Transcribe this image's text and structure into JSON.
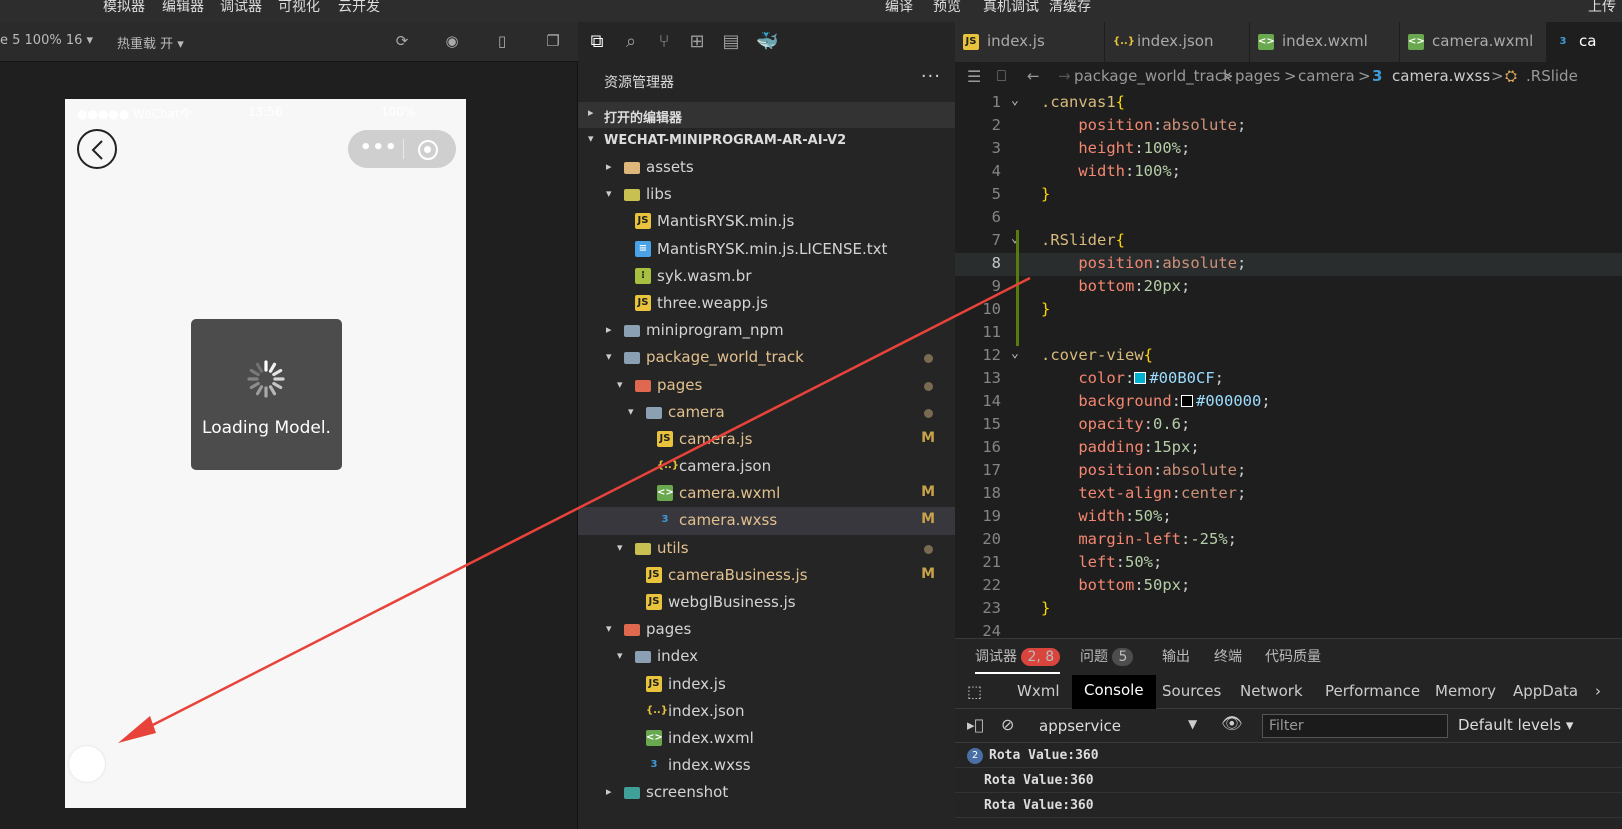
{
  "menu": {
    "items": [
      "模拟器",
      "编辑器",
      "调试器",
      "可视化",
      "云开发"
    ],
    "right_items": [
      "编译",
      "预览",
      "真机调试",
      "清缓存"
    ],
    "upload": "上传"
  },
  "simulator": {
    "device_label": "e 5 100% 16 ▾",
    "hot_reload": "热重载 开 ▾",
    "status_bar": {
      "signal": "●●●●● WeChat令",
      "time": "13:56",
      "battery": "100%"
    },
    "capsule_dots": "•••",
    "toast_text": "Loading Model."
  },
  "explorer": {
    "title": "资源管理器",
    "open_editors": "打开的编辑器",
    "project": "WECHAT-MINIPROGRAM-AR-AI-V2",
    "tree": [
      {
        "name": "assets",
        "type": "folder",
        "depth": 0,
        "arrow": "▸",
        "icon": "folder",
        "color": "folder"
      },
      {
        "name": "libs",
        "type": "folder",
        "depth": 0,
        "arrow": "▾",
        "icon": "folder",
        "color": "folder-g"
      },
      {
        "name": "MantisRYSK.min.js",
        "type": "file",
        "depth": 1,
        "icon": "JS",
        "color": "js"
      },
      {
        "name": "MantisRYSK.min.js.LICENSE.txt",
        "type": "file",
        "depth": 1,
        "icon": "≡",
        "color": "txtf"
      },
      {
        "name": "syk.wasm.br",
        "type": "file",
        "depth": 1,
        "icon": "⁝",
        "color": "br"
      },
      {
        "name": "three.weapp.js",
        "type": "file",
        "depth": 1,
        "icon": "JS",
        "color": "js"
      },
      {
        "name": "miniprogram_npm",
        "type": "folder",
        "depth": 0,
        "arrow": "▸",
        "icon": "folder",
        "color": "folder-b"
      },
      {
        "name": "package_world_track",
        "type": "folder",
        "depth": 0,
        "arrow": "▾",
        "icon": "folder",
        "color": "folder-b",
        "dot": true,
        "mod": true
      },
      {
        "name": "pages",
        "type": "folder",
        "depth": 1,
        "arrow": "▾",
        "icon": "folder",
        "color": "folder-r",
        "dot": true,
        "mod": true
      },
      {
        "name": "camera",
        "type": "folder",
        "depth": 2,
        "arrow": "▾",
        "icon": "folder",
        "color": "folder-b",
        "dot": true,
        "mod": true
      },
      {
        "name": "camera.js",
        "type": "file",
        "depth": 3,
        "icon": "JS",
        "color": "js",
        "badge": "M",
        "mod": true
      },
      {
        "name": "camera.json",
        "type": "file",
        "depth": 3,
        "icon": "{..}",
        "color": "json"
      },
      {
        "name": "camera.wxml",
        "type": "file",
        "depth": 3,
        "icon": "<>",
        "color": "wxml",
        "badge": "M",
        "mod": true
      },
      {
        "name": "camera.wxss",
        "type": "file",
        "depth": 3,
        "icon": "3",
        "color": "wxss",
        "badge": "M",
        "mod": true,
        "selected": true
      },
      {
        "name": "utils",
        "type": "folder",
        "depth": 1,
        "arrow": "▾",
        "icon": "folder",
        "color": "folder-g",
        "dot": true,
        "mod": true
      },
      {
        "name": "cameraBusiness.js",
        "type": "file",
        "depth": 2,
        "icon": "JS",
        "color": "js",
        "badge": "M",
        "mod": true
      },
      {
        "name": "webglBusiness.js",
        "type": "file",
        "depth": 2,
        "icon": "JS",
        "color": "js"
      },
      {
        "name": "pages",
        "type": "folder",
        "depth": 0,
        "arrow": "▾",
        "icon": "folder",
        "color": "folder-r"
      },
      {
        "name": "index",
        "type": "folder",
        "depth": 1,
        "arrow": "▾",
        "icon": "folder",
        "color": "folder-b"
      },
      {
        "name": "index.js",
        "type": "file",
        "depth": 2,
        "icon": "JS",
        "color": "js"
      },
      {
        "name": "index.json",
        "type": "file",
        "depth": 2,
        "icon": "{..}",
        "color": "json"
      },
      {
        "name": "index.wxml",
        "type": "file",
        "depth": 2,
        "icon": "<>",
        "color": "wxml"
      },
      {
        "name": "index.wxss",
        "type": "file",
        "depth": 2,
        "icon": "3",
        "color": "wxss"
      },
      {
        "name": "screenshot",
        "type": "folder",
        "depth": 0,
        "arrow": "▸",
        "icon": "folder",
        "color": "folder-t"
      }
    ]
  },
  "editor": {
    "tabs": [
      {
        "name": "index.js",
        "icon": "JS",
        "color": "js"
      },
      {
        "name": "index.json",
        "icon": "{..}",
        "color": "json"
      },
      {
        "name": "index.wxml",
        "icon": "<>",
        "color": "wxml"
      },
      {
        "name": "camera.wxml",
        "icon": "<>",
        "color": "wxml"
      },
      {
        "name": "ca",
        "icon": "3",
        "color": "wxss",
        "active": true
      }
    ],
    "breadcrumbs": [
      "package_world_track",
      ">",
      "pages",
      ">",
      "camera",
      ">",
      "camera.wxss",
      ">",
      ".RSlide"
    ],
    "current_line": 8,
    "lines": [
      {
        "n": "1",
        "fold": "⌄",
        "html": "<span class='sel-c'>.canvas1</span><span class='br-c'>{</span>"
      },
      {
        "n": "2",
        "html": "    <span class='prop2'>position</span>:<span class='val'>absolute</span>;"
      },
      {
        "n": "3",
        "html": "    <span class='prop2'>height</span>:<span class='num'>100%</span>;"
      },
      {
        "n": "4",
        "html": "    <span class='prop2'>width</span>:<span class='num'>100%</span>;"
      },
      {
        "n": "5",
        "html": "<span class='br-c'>}</span>"
      },
      {
        "n": "6",
        "html": ""
      },
      {
        "n": "7",
        "fold": "⌄",
        "html": "<span class='sel-c'>.RSlider</span><span class='br-c'>{</span>"
      },
      {
        "n": "8",
        "html": "    <span class='prop2'>position</span>:<span class='val'>absolute</span>;"
      },
      {
        "n": "9",
        "html": "    <span class='prop2'>bottom</span>:<span class='num'>20px</span>;"
      },
      {
        "n": "10",
        "html": "<span class='br-c'>}</span>"
      },
      {
        "n": "11",
        "html": ""
      },
      {
        "n": "12",
        "fold": "⌄",
        "html": "<span class='sel-c'>.cover-view</span><span class='br-c'>{</span>"
      },
      {
        "n": "13",
        "html": "    <span class='prop2'>color</span>:<span class='swatch' style='background:#00B0CF'></span><span class='prop'>#00B0CF</span>;"
      },
      {
        "n": "14",
        "html": "    <span class='prop2'>background</span>:<span class='swatch' style='background:#000000'></span><span class='prop'>#000000</span>;"
      },
      {
        "n": "15",
        "html": "    <span class='prop2'>opacity</span>:<span class='num'>0.6</span>;"
      },
      {
        "n": "16",
        "html": "    <span class='prop2'>padding</span>:<span class='num'>15px</span>;"
      },
      {
        "n": "17",
        "html": "    <span class='prop2'>position</span>:<span class='val'>absolute</span>;"
      },
      {
        "n": "18",
        "html": "    <span class='prop2'>text-align</span>:<span class='val'>center</span>;"
      },
      {
        "n": "19",
        "html": "    <span class='prop2'>width</span>:<span class='num'>50%</span>;"
      },
      {
        "n": "20",
        "html": "    <span class='prop2'>margin-left</span>:<span class='num'>-25%</span>;"
      },
      {
        "n": "21",
        "html": "    <span class='prop2'>left</span>:<span class='num'>50%</span>;"
      },
      {
        "n": "22",
        "html": "    <span class='prop2'>bottom</span>:<span class='num'>50px</span>;"
      },
      {
        "n": "23",
        "html": "<span class='br-c'>}</span>"
      },
      {
        "n": "24",
        "html": ""
      }
    ]
  },
  "panel": {
    "tabs": {
      "debugger": "调试器",
      "debugger_badge": "2, 8",
      "problems": "问题",
      "problems_badge": "5",
      "output": "输出",
      "terminal": "终端",
      "quality": "代码质量"
    },
    "devtools_tabs": [
      "Wxml",
      "Console",
      "Sources",
      "Network",
      "Performance",
      "Memory",
      "AppData"
    ],
    "context": "appservice",
    "filter_placeholder": "Filter",
    "levels": "Default levels ▾",
    "logs": [
      {
        "count": "2",
        "text": "Rota Value:360"
      },
      {
        "count": "",
        "text": "Rota Value:360"
      },
      {
        "count": "",
        "text": "Rota Value:360"
      }
    ]
  },
  "colors": {
    "accent": "#00B0CF",
    "arrow": "#e8433a",
    "badge_red": "#d9453d"
  }
}
